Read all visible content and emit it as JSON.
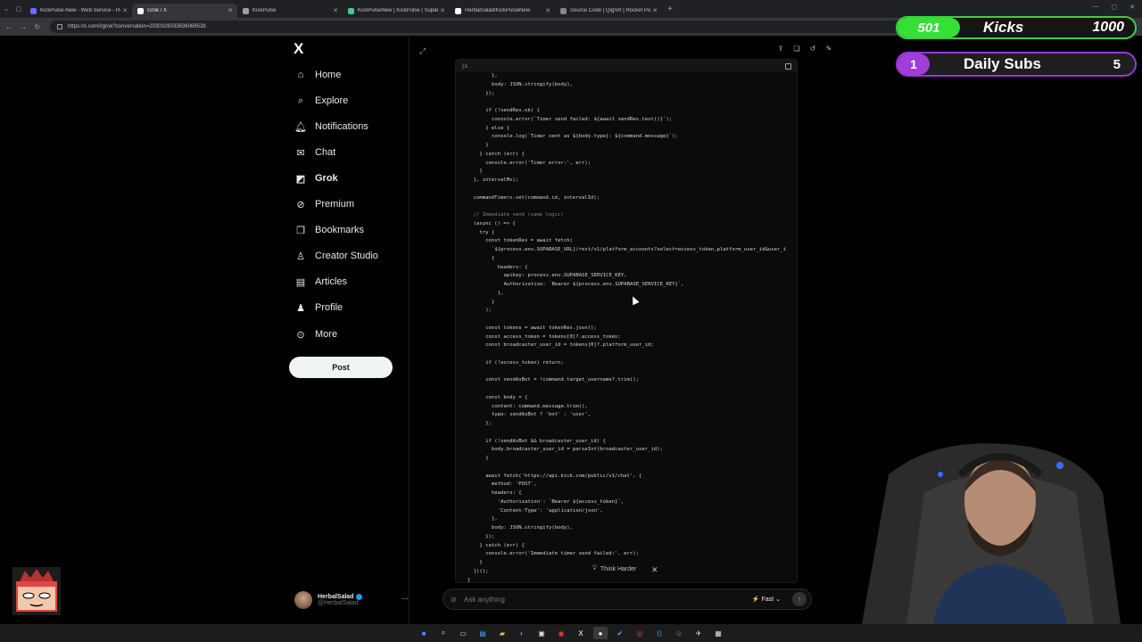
{
  "browser": {
    "tabs": [
      {
        "title": "KickPulse-New - Web Service - Re",
        "color": "#6b6bff",
        "active": false
      },
      {
        "title": "Grok / X",
        "color": "#ffffff",
        "active": true
      },
      {
        "title": "KickPulse",
        "color": "#9aa0a6",
        "active": false
      },
      {
        "title": "KickPulseNew | KickPulse | Supaba",
        "color": "#3ecf8e",
        "active": false
      },
      {
        "title": "HerbalSalad/KickPulseNew",
        "color": "#ffffff",
        "active": false
      },
      {
        "title": "Source Code | QigSR | Rocket Pos",
        "color": "#888888",
        "active": false
      }
    ],
    "url": "https://x.com/i/grok?conversation=2030326033636069528"
  },
  "sidebar": {
    "logo": "X",
    "items": [
      {
        "label": "Home",
        "icon": "home-icon"
      },
      {
        "label": "Explore",
        "icon": "search-icon"
      },
      {
        "label": "Notifications",
        "icon": "bell-icon"
      },
      {
        "label": "Chat",
        "icon": "mail-icon"
      },
      {
        "label": "Grok",
        "icon": "grok-icon"
      },
      {
        "label": "Premium",
        "icon": "premium-icon"
      },
      {
        "label": "Bookmarks",
        "icon": "bookmark-icon"
      },
      {
        "label": "Creator Studio",
        "icon": "creator-icon"
      },
      {
        "label": "Articles",
        "icon": "article-icon"
      },
      {
        "label": "Profile",
        "icon": "person-icon"
      },
      {
        "label": "More",
        "icon": "more-circle-icon"
      }
    ],
    "post_label": "Post",
    "profile": {
      "name": "HerbalSalad",
      "handle": "@HerbalSalad"
    }
  },
  "code": {
    "lang": "js",
    "lines": [
      {
        "indent": 10,
        "text": "},"
      },
      {
        "indent": 10,
        "text": "body: JSON.stringify(body),"
      },
      {
        "indent": 8,
        "text": "});"
      },
      {
        "indent": 0,
        "text": ""
      },
      {
        "indent": 8,
        "text": "if (!sendRes.ok) {"
      },
      {
        "indent": 10,
        "text": "console.error(`Timer send failed: ${await sendRes.text()}`);"
      },
      {
        "indent": 8,
        "text": "} else {"
      },
      {
        "indent": 10,
        "text": "console.log(`Timer sent as ${body.type}: ${command.message}`);"
      },
      {
        "indent": 8,
        "text": "}"
      },
      {
        "indent": 6,
        "text": "} catch (err) {"
      },
      {
        "indent": 8,
        "text": "console.error('Timer error:', err);"
      },
      {
        "indent": 6,
        "text": "}"
      },
      {
        "indent": 4,
        "text": "}, intervalMs);"
      },
      {
        "indent": 0,
        "text": ""
      },
      {
        "indent": 4,
        "text": "commandTimers.set(command.id, intervalId);"
      },
      {
        "indent": 0,
        "text": ""
      },
      {
        "indent": 4,
        "text": "// Immediate send (same logic)",
        "kind": "comment"
      },
      {
        "indent": 4,
        "text": "(async () => {"
      },
      {
        "indent": 6,
        "text": "try {"
      },
      {
        "indent": 8,
        "text": "const tokenRes = await fetch("
      },
      {
        "indent": 10,
        "text": "`${process.env.SUPABASE_URL}/rest/v1/platform_accounts?select=access_token,platform_user_id&user_i"
      },
      {
        "indent": 10,
        "text": "{"
      },
      {
        "indent": 12,
        "text": "headers: {"
      },
      {
        "indent": 14,
        "text": "apikey: process.env.SUPABASE_SERVICE_KEY,"
      },
      {
        "indent": 14,
        "text": "Authorization: `Bearer ${process.env.SUPABASE_SERVICE_KEY}`,"
      },
      {
        "indent": 12,
        "text": "},"
      },
      {
        "indent": 10,
        "text": "}"
      },
      {
        "indent": 8,
        "text": ");"
      },
      {
        "indent": 0,
        "text": ""
      },
      {
        "indent": 8,
        "text": "const tokens = await tokenRes.json();"
      },
      {
        "indent": 8,
        "text": "const access_token = tokens[0]?.access_token;"
      },
      {
        "indent": 8,
        "text": "const broadcaster_user_id = tokens[0]?.platform_user_id;"
      },
      {
        "indent": 0,
        "text": ""
      },
      {
        "indent": 8,
        "text": "if (!access_token) return;"
      },
      {
        "indent": 0,
        "text": ""
      },
      {
        "indent": 8,
        "text": "const sendAsBot = !command.target_username?.trim();"
      },
      {
        "indent": 0,
        "text": ""
      },
      {
        "indent": 8,
        "text": "const body = {"
      },
      {
        "indent": 10,
        "text": "content: command.message.trim(),"
      },
      {
        "indent": 10,
        "text": "type: sendAsBot ? 'bot' : 'user',"
      },
      {
        "indent": 8,
        "text": "};"
      },
      {
        "indent": 0,
        "text": ""
      },
      {
        "indent": 8,
        "text": "if (!sendAsBot && broadcaster_user_id) {"
      },
      {
        "indent": 10,
        "text": "body.broadcaster_user_id = parseInt(broadcaster_user_id);"
      },
      {
        "indent": 8,
        "text": "}"
      },
      {
        "indent": 0,
        "text": ""
      },
      {
        "indent": 8,
        "text": "await fetch('https://api.kick.com/public/v1/chat', {"
      },
      {
        "indent": 10,
        "text": "method: 'POST',"
      },
      {
        "indent": 10,
        "text": "headers: {"
      },
      {
        "indent": 12,
        "text": "'Authorization': `Bearer ${access_token}`,"
      },
      {
        "indent": 12,
        "text": "'Content-Type': 'application/json',"
      },
      {
        "indent": 10,
        "text": "},"
      },
      {
        "indent": 10,
        "text": "body: JSON.stringify(body),"
      },
      {
        "indent": 8,
        "text": "});"
      },
      {
        "indent": 6,
        "text": "} catch (err) {"
      },
      {
        "indent": 8,
        "text": "console.error('Immediate timer send failed:', err);"
      },
      {
        "indent": 6,
        "text": "}"
      },
      {
        "indent": 4,
        "text": "})();"
      },
      {
        "indent": 2,
        "text": "}"
      },
      {
        "indent": 0,
        "text": "}"
      }
    ]
  },
  "grok": {
    "think_harder": "Think Harder",
    "ask_placeholder": "Ask anything",
    "mode": "Fast"
  },
  "overlay": {
    "kicks": {
      "current": "501",
      "label": "Kicks",
      "goal": "1000"
    },
    "subs": {
      "current": "1",
      "label": "Daily Subs",
      "goal": "5"
    }
  },
  "colors": {
    "kicks_green": "#35e035",
    "subs_purple": "#a13dd8",
    "x_blue": "#1d9bf0"
  }
}
